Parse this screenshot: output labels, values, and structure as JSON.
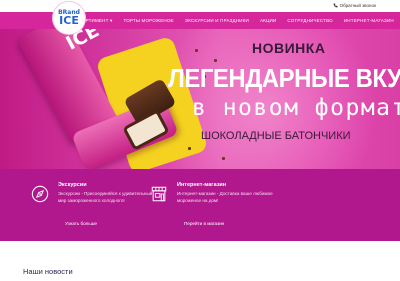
{
  "topbar": {
    "callback_label": "Обратный звонок",
    "phone_icon": "phone-icon"
  },
  "logo": {
    "top": "BRand",
    "bottom": "ICE"
  },
  "nav": {
    "items": [
      {
        "label": "Ассортимент",
        "has_dropdown": true
      },
      {
        "label": "Торты мороженое",
        "has_dropdown": false
      },
      {
        "label": "Экскурсии и праздники",
        "has_dropdown": false
      },
      {
        "label": "Акции",
        "has_dropdown": false
      },
      {
        "label": "Сотрудничество",
        "has_dropdown": false
      },
      {
        "label": "Интернет-магазин",
        "has_dropdown": false
      }
    ]
  },
  "hero": {
    "kicker": "НОВИНКА",
    "title_line1": "ЛЕГЕНДАРНЫЕ ВКУС",
    "title_line2": "в новом формате",
    "subtitle": "ШОКОЛАДНЫЕ БАТОНЧИКИ",
    "product_label": "ICE",
    "slides_count": 3,
    "active_slide": 0
  },
  "info": {
    "cards": [
      {
        "icon": "compass-icon",
        "title": "Экскурсии",
        "text": "Экскурсии - Присоединяйся к удивительный мир замороженного холодного!",
        "link": "Узнать больше"
      },
      {
        "icon": "shop-icon",
        "title": "Интернет-магазин",
        "text": "Интернет-магазин - Доставка ваше любимое мороженое на дом!",
        "link": "Перейти в магазин"
      }
    ]
  },
  "news": {
    "title": "Наши новости"
  },
  "colors": {
    "brand_pink": "#d6269b",
    "band": "#b2188d",
    "logo_blue": "#2563c9",
    "accent_yellow": "#f5d21f"
  }
}
